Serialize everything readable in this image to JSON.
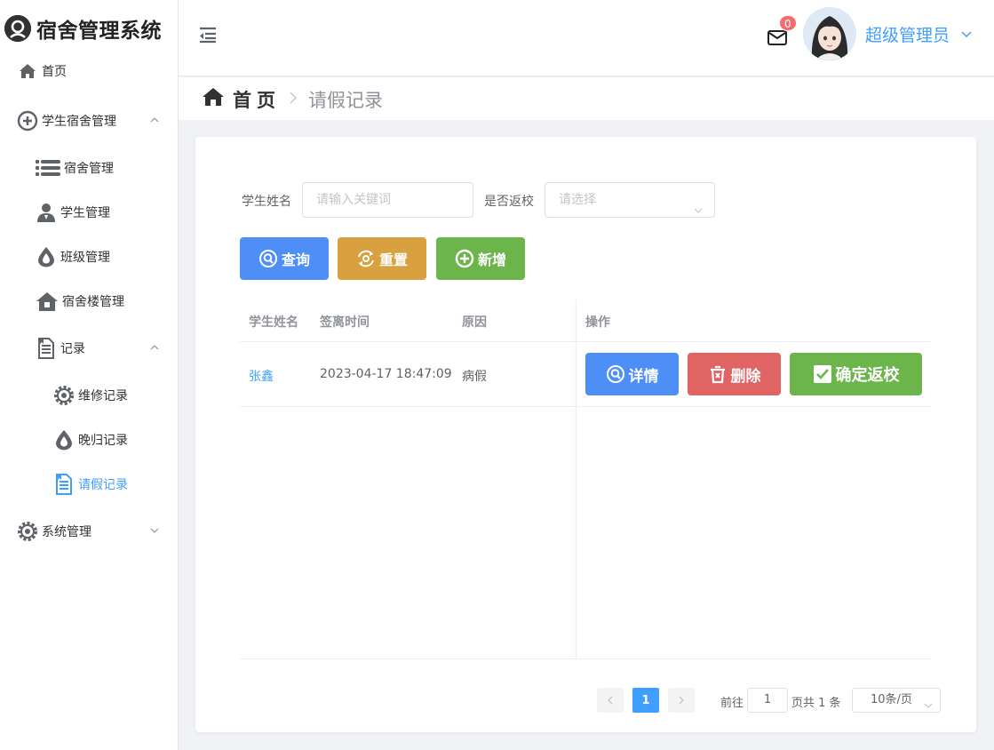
{
  "app": {
    "title": "宿舍管理系统"
  },
  "sidebar": {
    "items": [
      {
        "label": "首页",
        "icon": "home-icon"
      },
      {
        "label": "学生宿舍管理",
        "icon": "plus-circle-icon",
        "expanded": true
      },
      {
        "label": "宿舍管理",
        "icon": "list-icon"
      },
      {
        "label": "学生管理",
        "icon": "user-icon"
      },
      {
        "label": "班级管理",
        "icon": "drop-icon"
      },
      {
        "label": "宿舍楼管理",
        "icon": "building-icon"
      },
      {
        "label": "记录",
        "icon": "document-icon",
        "expanded": true
      },
      {
        "label": "维修记录",
        "icon": "gear-icon"
      },
      {
        "label": "晚归记录",
        "icon": "drop-icon"
      },
      {
        "label": "请假记录",
        "icon": "document-icon",
        "active": true
      },
      {
        "label": "系统管理",
        "icon": "gear-icon",
        "expanded": false
      }
    ]
  },
  "header": {
    "mail_badge": "0",
    "user_name": "超级管理员"
  },
  "breadcrumb": {
    "home": "首页",
    "current": "请假记录"
  },
  "search": {
    "name_label": "学生姓名",
    "name_placeholder": "请输入关键词",
    "return_label": "是否返校",
    "return_placeholder": "请选择"
  },
  "buttons": {
    "query": "查询",
    "reset": "重置",
    "add": "新增",
    "detail": "详情",
    "delete": "删除",
    "confirm_return": "确定返校"
  },
  "table": {
    "headers": [
      "学生姓名",
      "签离时间",
      "原因",
      "操作"
    ],
    "rows": [
      {
        "name": "张鑫",
        "time": "2023-04-17 18:47:09",
        "reason": "病假"
      }
    ]
  },
  "pagination": {
    "current_page": "1",
    "goto_label": "前往",
    "goto_value": "1",
    "total_label": "页共 1 条",
    "page_size": "10条/页"
  },
  "colors": {
    "primary": "#409eff",
    "query_button": "#4e8ff7",
    "reset_button": "#d9a040",
    "add_button": "#6cb54a",
    "delete_button": "#e06464"
  }
}
